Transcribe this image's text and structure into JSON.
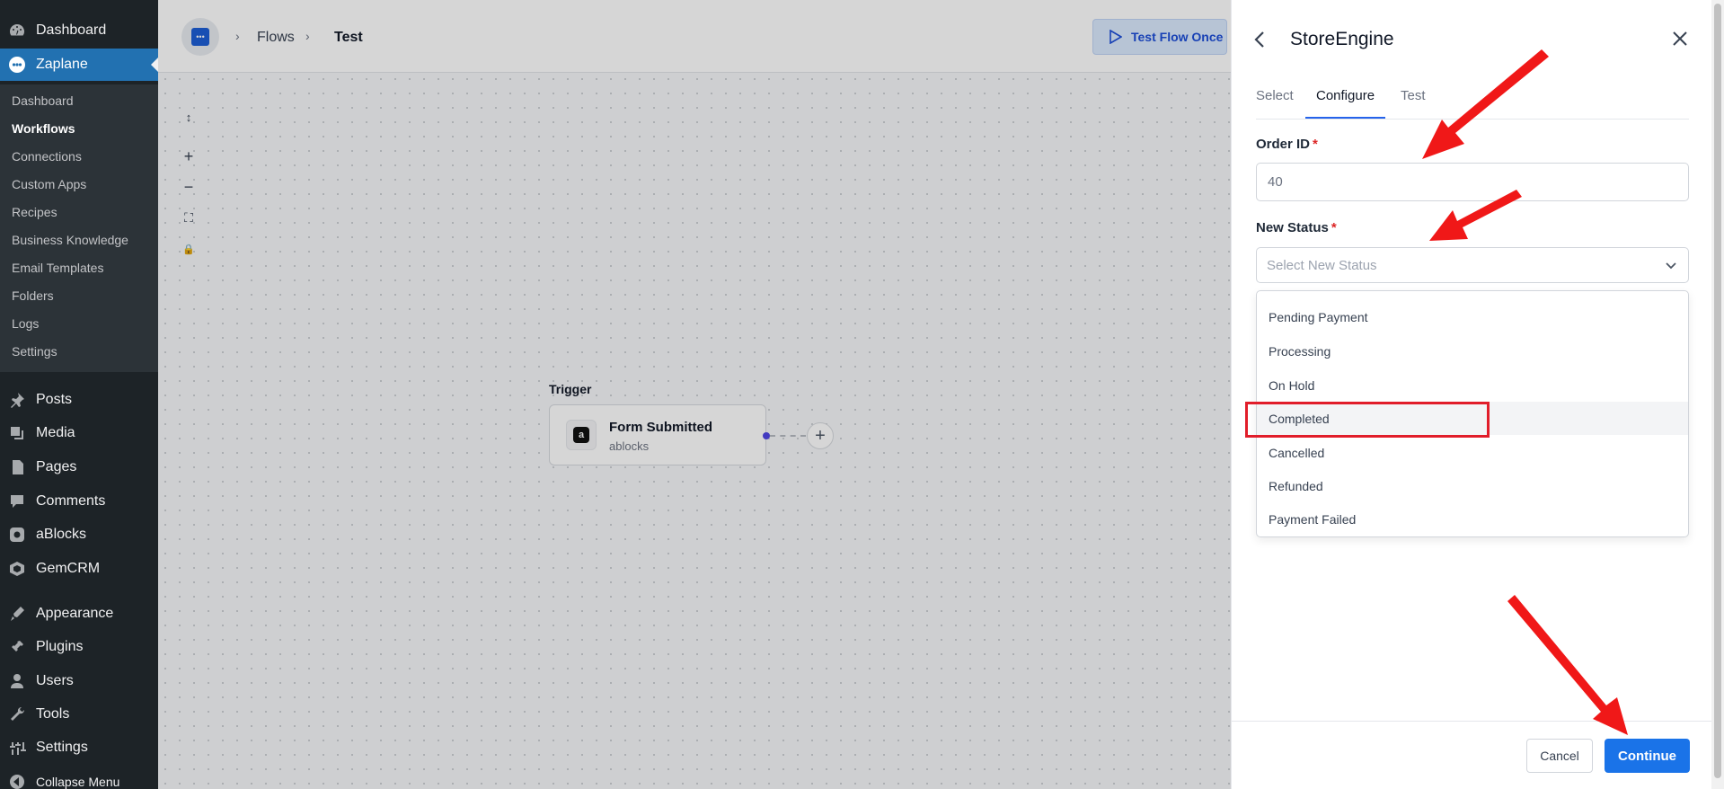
{
  "sidebar": {
    "top": [
      {
        "label": "Dashboard",
        "icon": "dashboard-icon"
      },
      {
        "label": "Zaplane",
        "icon": "zaplane-icon"
      }
    ],
    "submenu": [
      "Dashboard",
      "Workflows",
      "Connections",
      "Custom Apps",
      "Recipes",
      "Business Knowledge",
      "Email Templates",
      "Folders",
      "Logs",
      "Settings"
    ],
    "menu": [
      {
        "label": "Posts",
        "icon": "pin-icon"
      },
      {
        "label": "Media",
        "icon": "media-icon"
      },
      {
        "label": "Pages",
        "icon": "pages-icon"
      },
      {
        "label": "Comments",
        "icon": "comments-icon"
      },
      {
        "label": "aBlocks",
        "icon": "ablocks-icon"
      },
      {
        "label": "GemCRM",
        "icon": "gemcrm-icon"
      },
      {
        "label": "Appearance",
        "icon": "appearance-icon"
      },
      {
        "label": "Plugins",
        "icon": "plugins-icon"
      },
      {
        "label": "Users",
        "icon": "users-icon"
      },
      {
        "label": "Tools",
        "icon": "tools-icon"
      },
      {
        "label": "Settings",
        "icon": "settings-icon"
      },
      {
        "label": "Collapse Menu",
        "icon": "collapse-icon"
      }
    ]
  },
  "topbar": {
    "breadcrumb": [
      "Flows",
      "Test"
    ],
    "test_flow_label": "Test Flow Once"
  },
  "canvas": {
    "tools": [
      "↕",
      "+",
      "−",
      "⛶",
      "🔒"
    ],
    "trigger_label": "Trigger",
    "node_title": "Form Submitted",
    "node_subtitle": "ablocks",
    "node_icon_letter": "a"
  },
  "panel": {
    "title": "StoreEngine",
    "tabs": [
      "Select",
      "Configure",
      "Test"
    ],
    "active_tab": "Configure",
    "order_id_label": "Order ID",
    "order_id_value": "40",
    "status_label": "New Status",
    "required_mark": "*",
    "status_placeholder": "Select New Status",
    "status_options": [
      "Pending Payment",
      "Processing",
      "On Hold",
      "Completed",
      "Cancelled",
      "Refunded",
      "Payment Failed"
    ],
    "highlighted_option": "Completed",
    "cancel_label": "Cancel",
    "continue_label": "Continue"
  },
  "colors": {
    "accent": "#1a73e8",
    "wp_active": "#2271b1",
    "annotation": "#e11d2a"
  }
}
